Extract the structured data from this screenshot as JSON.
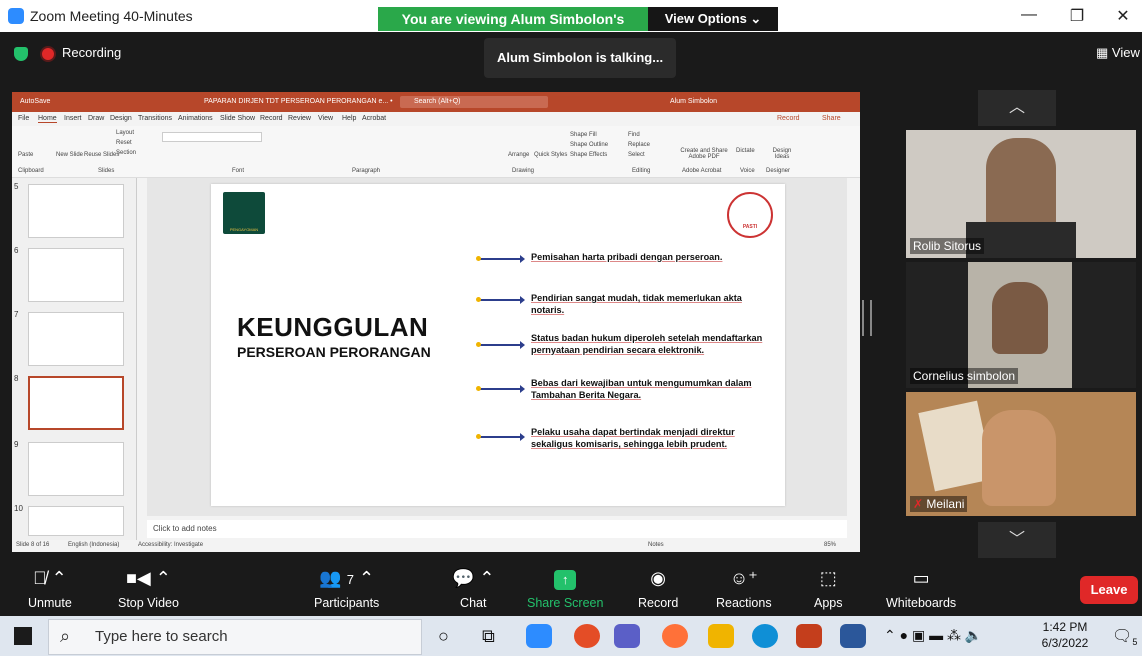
{
  "window": {
    "title": "Zoom Meeting 40-Minutes",
    "banner": "You are viewing Alum Simbolon's screen",
    "view_options": "View Options ⌄"
  },
  "status": {
    "recording": "Recording",
    "talking": "Alum Simbolon is talking...",
    "view": "View"
  },
  "ppt": {
    "doc_title": "PAPARAN DIRJEN TDT PERSEROAN PERORANGAN e... •",
    "search_placeholder": "Search (Alt+Q)",
    "user": "Alum Simbolon",
    "autosave": "AutoSave",
    "menu": [
      "File",
      "Home",
      "Insert",
      "Draw",
      "Design",
      "Transitions",
      "Animations",
      "Slide Show",
      "Record",
      "Review",
      "View",
      "Help",
      "Acrobat"
    ],
    "record_label": "Record",
    "share_label": "Share",
    "ribbon": {
      "paste": "Paste",
      "new_slide": "New Slide",
      "reuse_slides": "Reuse Slides",
      "layout": "Layout",
      "reset": "Reset",
      "section": "Section",
      "clipboard": "Clipboard",
      "slides": "Slides",
      "font": "Font",
      "paragraph": "Paragraph",
      "drawing": "Drawing",
      "editing": "Editing",
      "find": "Find",
      "replace": "Replace",
      "select": "Select",
      "adobe": "Create and Share Adobe PDF",
      "adobe_group": "Adobe Acrobat",
      "dictate": "Dictate",
      "voice": "Voice",
      "design_ideas": "Design Ideas",
      "designer": "Designer",
      "arrange": "Arrange",
      "quick_styles": "Quick Styles",
      "shape_fill": "Shape Fill",
      "shape_outline": "Shape Outline",
      "shape_effects": "Shape Effects"
    },
    "thumb_numbers": [
      "5",
      "6",
      "7",
      "8",
      "9",
      "10"
    ],
    "notes_placeholder": "Click to add notes",
    "status_left": "Slide 8 of 16",
    "status_lang": "English (Indonesia)",
    "status_access": "Accessibility: Investigate",
    "status_notes": "Notes",
    "zoom_level": "85%"
  },
  "slide": {
    "title": "KEUNGGULAN",
    "subtitle": "PERSEROAN PERORANGAN",
    "logo_left": "PENGAYOMAN",
    "logo_right": "PASTI",
    "bullets": [
      "Pemisahan harta pribadi dengan perseroan.",
      "Pendirian sangat mudah, tidak memerlukan akta notaris.",
      "Status badan hukum diperoleh setelah mendaftarkan pernyataan pendirian secara elektronik.",
      "Bebas dari kewajiban untuk mengumumkan dalam Tambahan Berita Negara.",
      "Pelaku usaha dapat bertindak menjadi direktur sekaligus komisaris, sehingga lebih prudent."
    ]
  },
  "participants": [
    {
      "name": "Rolib Sitorus"
    },
    {
      "name": "Cornelius simbolon"
    },
    {
      "name": "Meilani"
    }
  ],
  "toolbar": {
    "unmute": "Unmute",
    "stop_video": "Stop Video",
    "participants": "Participants",
    "participant_count": "7",
    "chat": "Chat",
    "share_screen": "Share Screen",
    "record": "Record",
    "reactions": "Reactions",
    "apps": "Apps",
    "whiteboards": "Whiteboards",
    "leave": "Leave"
  },
  "taskbar": {
    "search_placeholder": "Type here to search",
    "time": "1:42 PM",
    "date": "6/3/2022",
    "notifications": "5"
  },
  "colors": {
    "zoom_blue": "#2d8cff",
    "share_green": "#23c16b",
    "leave_red": "#e02828",
    "ppt_red": "#b7472a"
  }
}
